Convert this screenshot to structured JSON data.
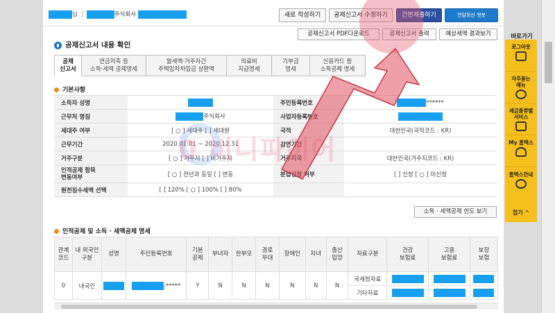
{
  "header": {
    "user_suffix": "님",
    "company_suffix": "주식회사",
    "buttons": [
      {
        "label": "새로 작성하기"
      },
      {
        "label": "공제신고서 수정하기"
      },
      {
        "label": "간편제출하기"
      },
      {
        "label": "연말정산 챗봇"
      }
    ]
  },
  "section_buttons": [
    {
      "label": "공제신고서 PDF다운로드"
    },
    {
      "label": "공제신고서 출력"
    },
    {
      "label": "예상세액 결과보기"
    }
  ],
  "page_title": "공제신고서 내용 확인",
  "tabs": [
    {
      "label": "공제\n신고서"
    },
    {
      "label": "연금저축 등\n소득·세액 공제명세"
    },
    {
      "label": "월세액·거주자간\n주택임차차입금 상환액"
    },
    {
      "label": "의료비\n지급명세"
    },
    {
      "label": "기부금\n명세"
    },
    {
      "label": "신용카드 등\n소득공제 명세"
    }
  ],
  "basic": {
    "title": "기본사항",
    "rows": [
      {
        "l1": "소득자 성명",
        "v1": "",
        "l2": "주민등록번호",
        "v2": "******"
      },
      {
        "l1": "근무처 명칭",
        "v1": "주식회사",
        "l2": "사업자등록번호",
        "v2": ""
      },
      {
        "l1": "세대주 여부",
        "v1": "[ ○ ] 세대주  [    ] 세대원",
        "l2": "국적",
        "v2": "대한민국(국적코드 : KR)"
      },
      {
        "l1": "근무기간",
        "v1": "2020.01.01 ~ 2020.12.31",
        "l2": "감면기간",
        "v2": ""
      },
      {
        "l1": "거주구분",
        "v1": "[ ○ ] 거주자  [    ] 비거주자",
        "l2": "거주지국",
        "v2": "대한민국(거주지코드 : KR)"
      },
      {
        "l1": "인적공제 항목\n변동여부",
        "v1": "[ ○ ] 전년과 동일  [    ] 변동",
        "l2": "분납신청 여부",
        "v2": "[    ] 신청  [ ○ ] 미신청"
      },
      {
        "l1": "원천징수세액 선택",
        "v1": "[    ] 120%  [ ○ ] 100%  [    ] 80%",
        "l2": "",
        "v2": ""
      }
    ]
  },
  "limit_button": "소득 · 세액공제 한도 보기",
  "deduction": {
    "title": "인적공제 및 소득 · 세액공제 명세",
    "headers": [
      "관계\n코드",
      "내 외국인\n구분",
      "성명",
      "주민등록번호",
      "기본\n공제",
      "부녀자",
      "한부모",
      "경로\n우대",
      "장애인",
      "자녀",
      "출산\n입양",
      "자료구분",
      "건강\n보험료",
      "고용\n보험료",
      "보장\n보험"
    ],
    "rows": [
      {
        "code": "0",
        "nat": "내국인",
        "name": "",
        "rrn": "-*****",
        "basic": "Y",
        "c1": "N",
        "c2": "N",
        "c3": "N",
        "c4": "N",
        "c5": "N",
        "c6": "N",
        "source": "국세청자료"
      },
      {
        "code": "",
        "nat": "",
        "name": "",
        "rrn": "",
        "basic": "",
        "c1": "",
        "c2": "",
        "c3": "",
        "c4": "",
        "c5": "",
        "c6": "",
        "source": "기타자료"
      }
    ]
  },
  "watermark": "0 비니파이어",
  "sidebar": {
    "title": "바로가기",
    "items": [
      {
        "label": "로그아웃"
      },
      {
        "label": "자주묻는\n메뉴"
      },
      {
        "label": "세금종류별\n서비스"
      },
      {
        "label": "My 홈택스"
      },
      {
        "label": "홈택스안내"
      }
    ],
    "close": "접기 ^"
  },
  "colors": {
    "redact": "#17a0f0",
    "accent": "#2a4fa0",
    "sidebar": "#f5bf1e",
    "highlight": "#eb5a6e"
  }
}
